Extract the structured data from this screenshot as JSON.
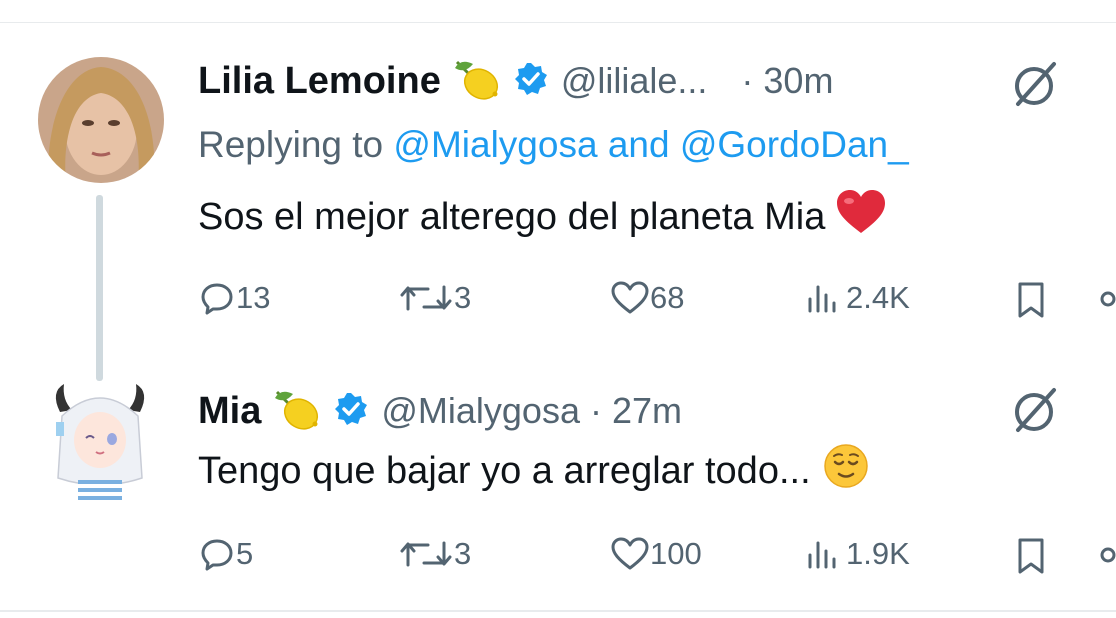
{
  "tweets": [
    {
      "author": "Lilia Lemoine",
      "handle": "@liliale...",
      "time": "· 30m",
      "reply_prefix": "Replying to",
      "reply_to_1": "@Mialygosa",
      "reply_and": "and",
      "reply_to_2": "@GordoDan_",
      "text": "Sos el mejor alterego del planeta Mia",
      "emoji": "heart-emoji",
      "stats": {
        "replies": "13",
        "reposts": "3",
        "likes": "68",
        "views": "2.4K"
      }
    },
    {
      "author": "Mia",
      "handle": "@Mialygosa",
      "time": "· 27m",
      "text": "Tengo que bajar yo a arreglar todo...",
      "emoji": "relieved-face-emoji",
      "stats": {
        "replies": "5",
        "reposts": "3",
        "likes": "100",
        "views": "1.9K"
      }
    }
  ],
  "colors": {
    "verified": "#1d9bf0",
    "link": "#1d9bf0",
    "muted": "#536471",
    "heart": "#e0245e"
  }
}
